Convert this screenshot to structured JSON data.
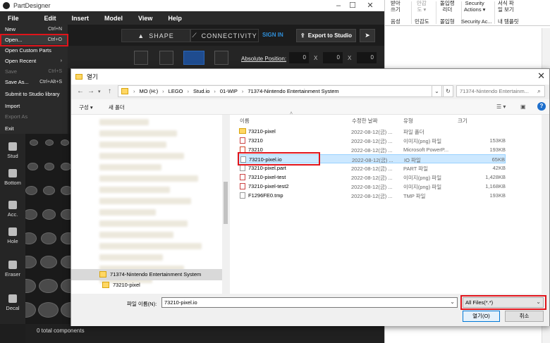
{
  "pd": {
    "title": "PartDesigner",
    "menu": [
      "File",
      "Edit",
      "Insert",
      "Model",
      "View",
      "Help"
    ],
    "tabs": {
      "shape": "SHAPE",
      "connectivity": "CONNECTIVITY"
    },
    "signin": "SIGN IN",
    "export": "Export to Studio",
    "abs_pos_label": "Absolute Position:",
    "coords": [
      {
        "label": "",
        "value": "0"
      },
      {
        "label": "X",
        "value": "0"
      },
      {
        "label": "X",
        "value": "0"
      }
    ],
    "side_tools": [
      "Stud",
      "Bottom",
      "Acc.",
      "Hole",
      "Eraser",
      "Decal"
    ],
    "status": "0 total components"
  },
  "file_menu": [
    {
      "label": "New",
      "shortcut": "Ctrl+N",
      "disabled": false
    },
    {
      "label": "Open...",
      "shortcut": "Ctrl+O",
      "disabled": false,
      "selected": true
    },
    {
      "label": "Open Custom Parts",
      "shortcut": "",
      "disabled": false
    },
    {
      "label": "Open Recent",
      "shortcut": "›",
      "disabled": false
    },
    {
      "label": "Save",
      "shortcut": "Ctrl+S",
      "disabled": true
    },
    {
      "label": "Save As...",
      "shortcut": "Ctrl+Alt+S",
      "disabled": false
    },
    {
      "label": "Submit to Studio library",
      "shortcut": "",
      "disabled": false
    },
    {
      "label": "Import",
      "shortcut": "",
      "disabled": false
    },
    {
      "label": "Export As",
      "shortcut": "",
      "disabled": true
    },
    {
      "label": "Exit",
      "shortcut": "",
      "disabled": false
    }
  ],
  "korean_app": {
    "buttons": [
      {
        "top": "받아",
        "bottom": "쓰기",
        "gray": false
      },
      {
        "top": "맞춤",
        "bottom": "법",
        "gray": true
      },
      {
        "top": "만감",
        "bottom": "도 ▾",
        "gray": true
      },
      {
        "top": "돌입랭",
        "bottom": "리더",
        "gray": false
      },
      {
        "top": "Security",
        "bottom": "Actions ▾",
        "gray": false
      },
      {
        "top": "서식 파",
        "bottom": "일 보기",
        "gray": false
      }
    ],
    "groups": [
      "음성",
      "민감도",
      "몰입형",
      "Security Ac...",
      "내 템플릿"
    ]
  },
  "dialog": {
    "title": "열기",
    "path": [
      "MO (H:)",
      "LEGO",
      "Stud.io",
      "01-WIP",
      "71374-Nintendo Entertainment System"
    ],
    "search_placeholder": "71374-Nintendo Entertainm...",
    "cmd_organize": "구성 ▾",
    "cmd_new_folder": "새 폴더",
    "nav_selected": "71374-Nintendo Entertainment System",
    "nav_child": "73210-pixel",
    "columns": {
      "name": "이름",
      "date": "수정한 날짜",
      "type": "유형",
      "size": "크기"
    },
    "files": [
      {
        "name": "73210-pixel",
        "date": "2022-08-12(금) ...",
        "type": "파일 폴더",
        "size": "",
        "icon": "folder"
      },
      {
        "name": "73210",
        "date": "2022-08-12(금) ...",
        "type": "이미지(png) 파일",
        "size": "153KB",
        "icon": "png"
      },
      {
        "name": "73210",
        "date": "2022-08-12(금) ...",
        "type": "Microsoft PowerP...",
        "size": "193KB",
        "icon": "ppt"
      },
      {
        "name": "73210-pixel.io",
        "date": "2022-08-12(금) ...",
        "type": "IO 파일",
        "size": "65KB",
        "icon": "file",
        "selected": true
      },
      {
        "name": "73210-pixel.part",
        "date": "2022-08-12(금) ...",
        "type": "PART 파일",
        "size": "42KB",
        "icon": "file"
      },
      {
        "name": "73210-pixel-test",
        "date": "2022-08-12(금) ...",
        "type": "이미지(png) 파일",
        "size": "1,428KB",
        "icon": "png"
      },
      {
        "name": "73210-pixel-test2",
        "date": "2022-08-12(금) ...",
        "type": "이미지(png) 파일",
        "size": "1,168KB",
        "icon": "png"
      },
      {
        "name": "F1296FE0.tmp",
        "date": "2022-08-12(금) ...",
        "type": "TMP 파일",
        "size": "193KB",
        "icon": "file"
      }
    ],
    "filename_label": "파일 이름(N):",
    "filename_value": "73210-pixel.io",
    "filter_value": "All Files(*.*)",
    "open_label": "열기(O)",
    "cancel_label": "취소"
  }
}
